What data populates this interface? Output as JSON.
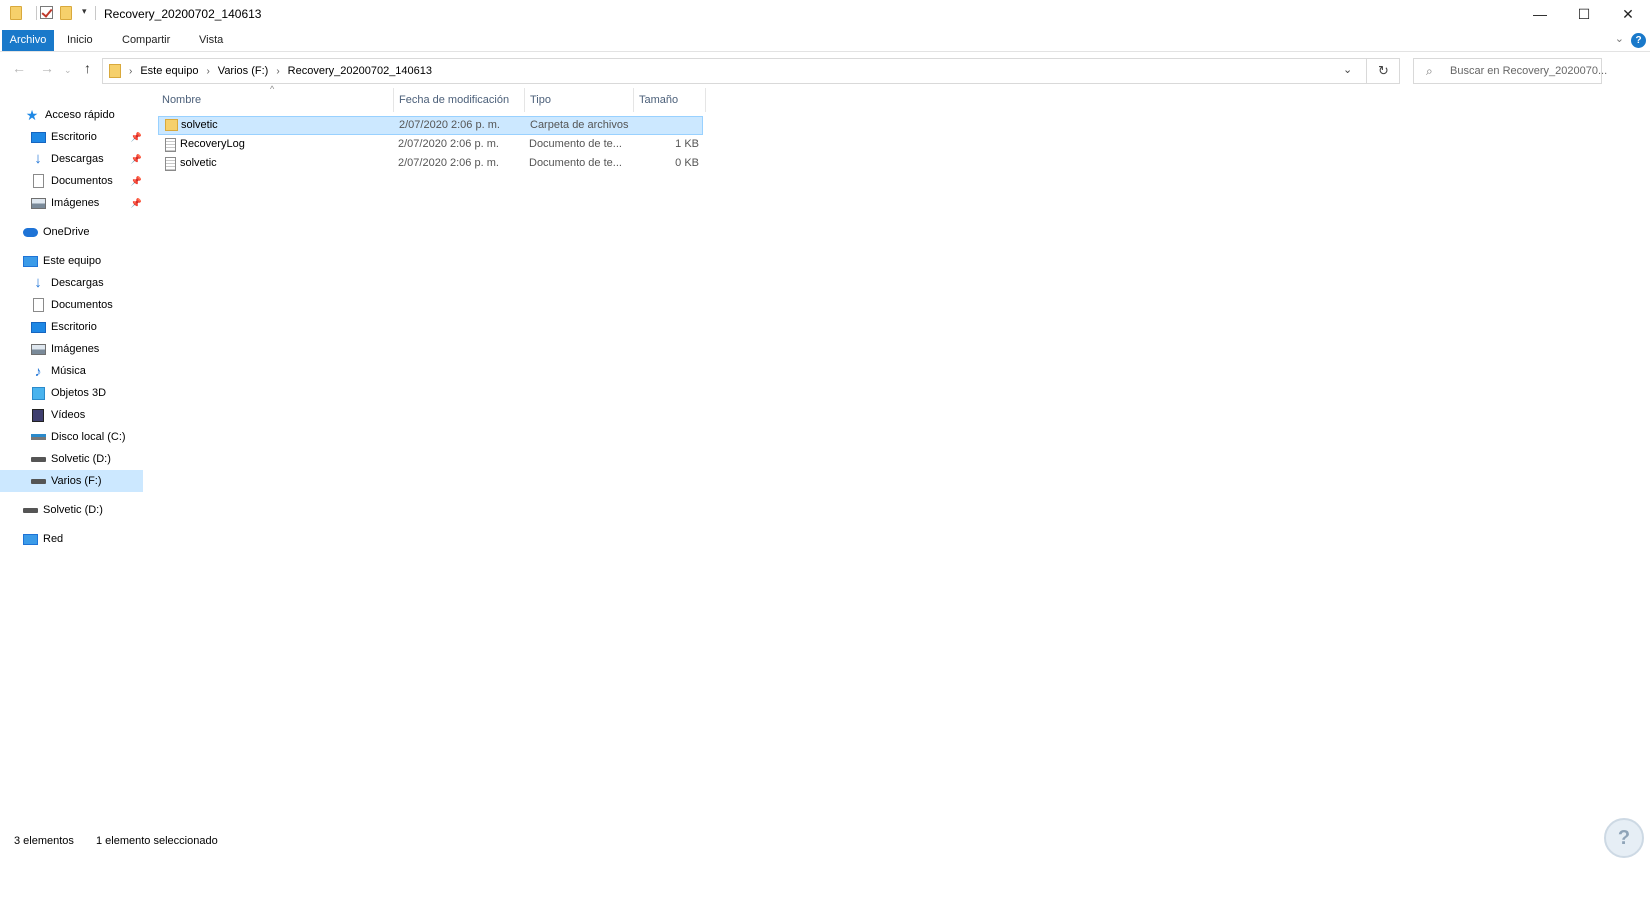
{
  "window": {
    "title": "Recovery_20200702_140613",
    "controls": {
      "minimize": "—",
      "maximize": "☐",
      "close": "✕"
    }
  },
  "ribbon": {
    "tabs": [
      "Archivo",
      "Inicio",
      "Compartir",
      "Vista"
    ],
    "help": "?"
  },
  "address": {
    "crumbs": [
      "Este equipo",
      "Varios (F:)",
      "Recovery_20200702_140613"
    ]
  },
  "search": {
    "placeholder": "Buscar en Recovery_2020070..."
  },
  "nav": {
    "quick_access": "Acceso rápido",
    "quick_items": [
      "Escritorio",
      "Descargas",
      "Documentos",
      "Imágenes"
    ],
    "onedrive": "OneDrive",
    "this_pc": "Este equipo",
    "pc_items": [
      "Descargas",
      "Documentos",
      "Escritorio",
      "Imágenes",
      "Música",
      "Objetos 3D",
      "Vídeos",
      "Disco local (C:)",
      "Solvetic (D:)",
      "Varios (F:)"
    ],
    "solvetic_d": "Solvetic (D:)",
    "network": "Red"
  },
  "columns": {
    "name": "Nombre",
    "date": "Fecha de modificación",
    "type": "Tipo",
    "size": "Tamaño"
  },
  "files": [
    {
      "name": "solvetic",
      "date": "2/07/2020 2:06 p. m.",
      "type": "Carpeta de archivos",
      "size": "",
      "icon": "folder-icon",
      "selected": true
    },
    {
      "name": "RecoveryLog",
      "date": "2/07/2020 2:06 p. m.",
      "type": "Documento de te...",
      "size": "1 KB",
      "icon": "text-file-icon",
      "selected": false
    },
    {
      "name": "solvetic",
      "date": "2/07/2020 2:06 p. m.",
      "type": "Documento de te...",
      "size": "0 KB",
      "icon": "text-file-icon",
      "selected": false
    }
  ],
  "status": {
    "count": "3 elementos",
    "selection": "1 elemento seleccionado"
  },
  "colors": {
    "accent": "#1979ca",
    "selection": "#cce8ff",
    "folder": "#f6d06b"
  }
}
